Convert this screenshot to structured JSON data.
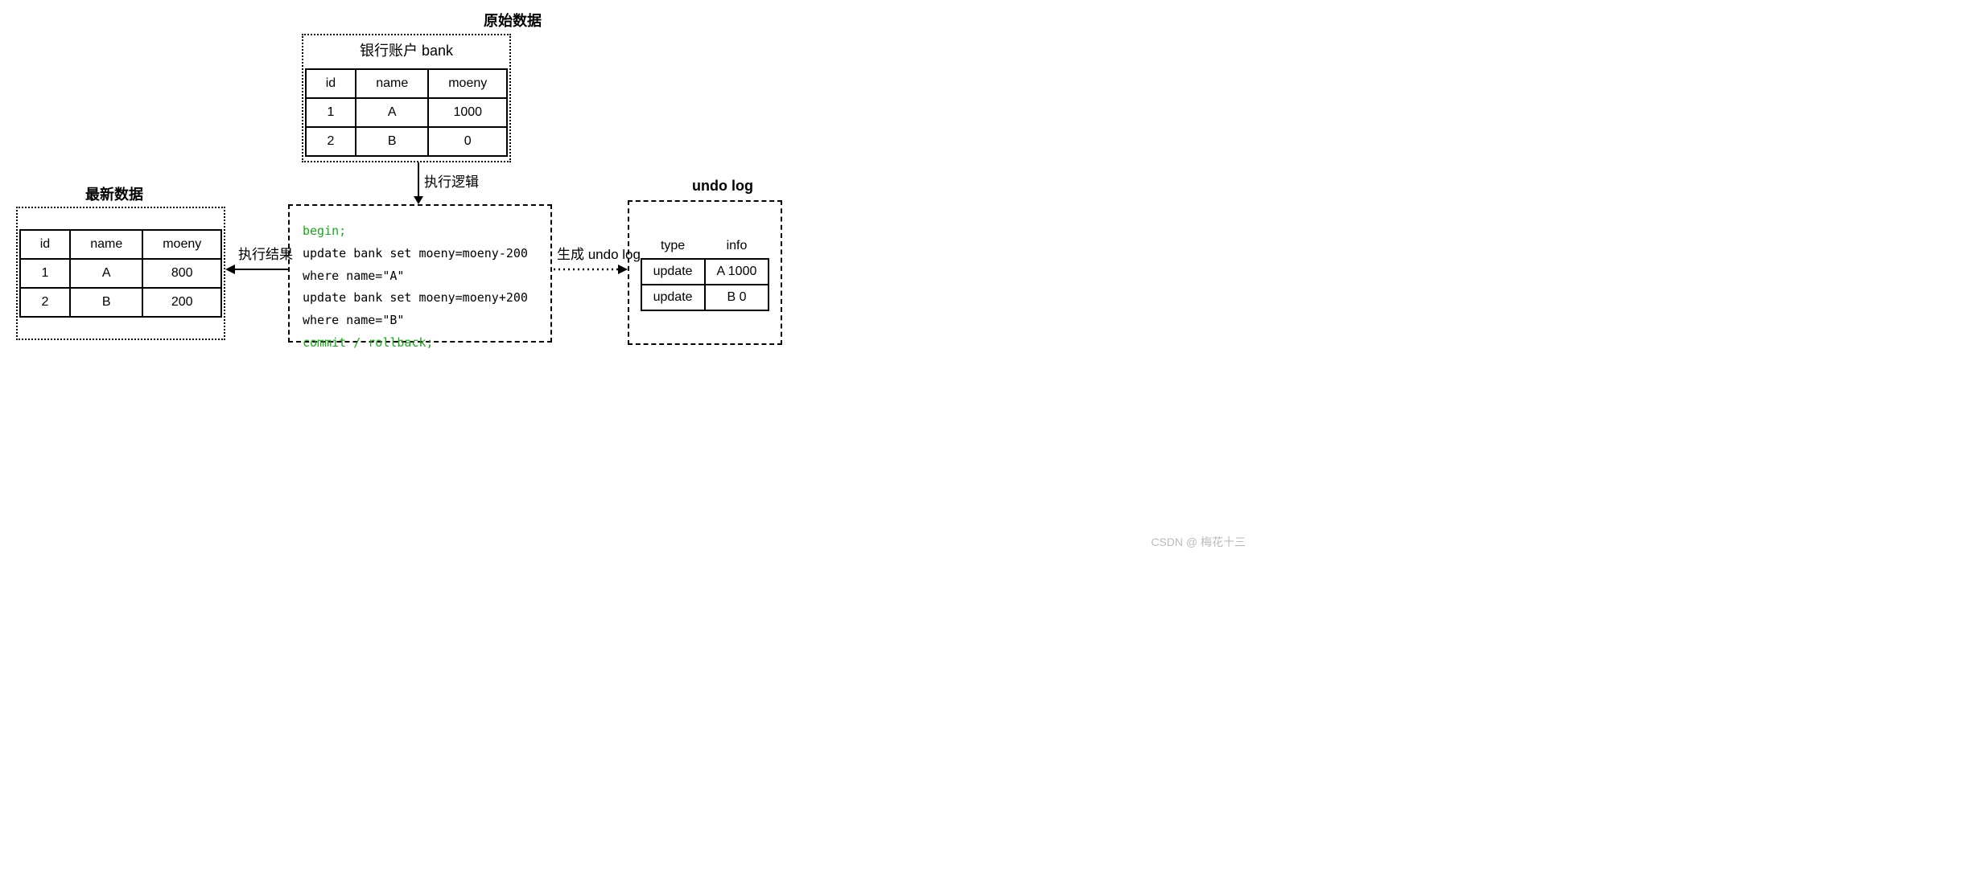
{
  "titles": {
    "original": "原始数据",
    "latest": "最新数据",
    "undo": "undo log",
    "bank_table": "银行账户 bank"
  },
  "arrows": {
    "exec_logic": "执行逻辑",
    "exec_result": "执行结果",
    "gen_undo": "生成 undo log"
  },
  "bank_table": {
    "headers": [
      "id",
      "name",
      "moeny"
    ],
    "rows": [
      [
        "1",
        "A",
        "1000"
      ],
      [
        "2",
        "B",
        "0"
      ]
    ]
  },
  "latest_table": {
    "headers": [
      "id",
      "name",
      "moeny"
    ],
    "rows": [
      [
        "1",
        "A",
        "800"
      ],
      [
        "2",
        "B",
        "200"
      ]
    ]
  },
  "undo_table": {
    "headers": [
      "type",
      "info"
    ],
    "rows": [
      [
        "update",
        "A 1000"
      ],
      [
        "update",
        "B 0"
      ]
    ]
  },
  "code": {
    "begin": "begin;",
    "stmt1": "update bank set moeny=moeny-200 where name=\"A\"",
    "stmt2": "update bank set moeny=moeny+200 where name=\"B\"",
    "commit": "commit / rollback;"
  },
  "watermark": "CSDN @ 梅花十三"
}
